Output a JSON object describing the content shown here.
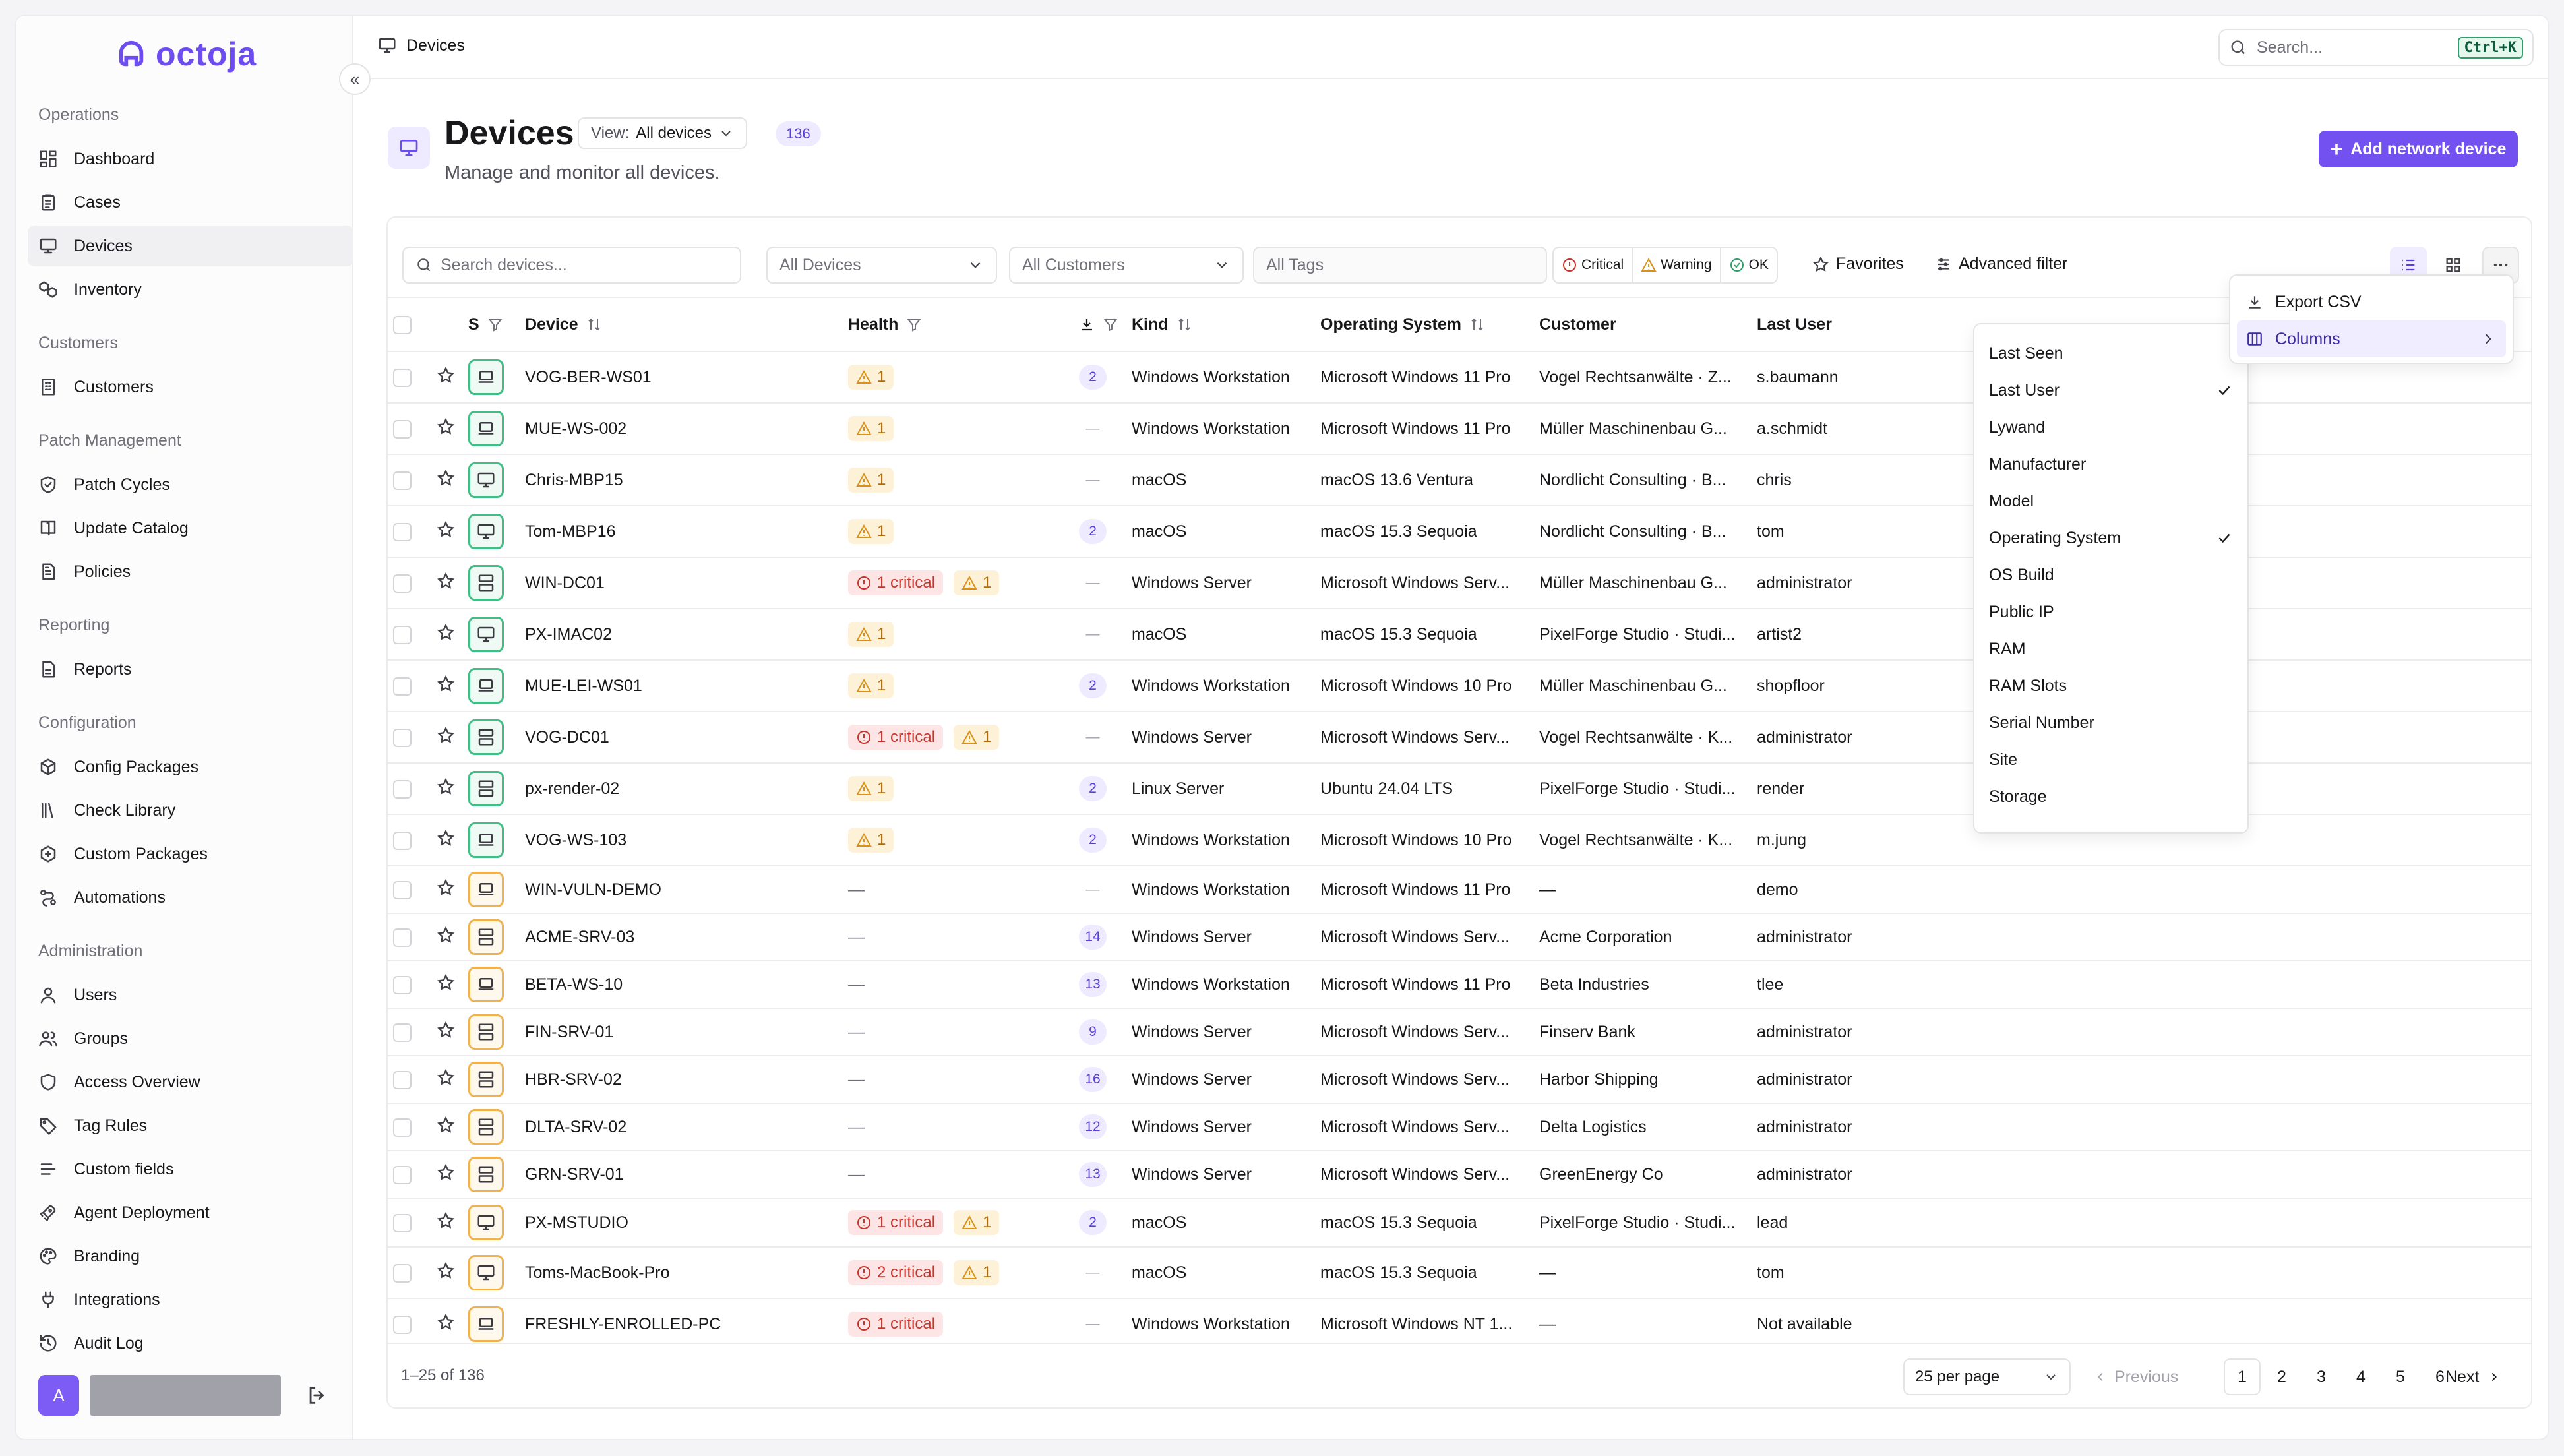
{
  "app": {
    "name": "octoja"
  },
  "sidebar": {
    "sections": [
      {
        "title": "Operations",
        "items": [
          {
            "label": "Dashboard",
            "icon": "dashboard-icon",
            "active": false
          },
          {
            "label": "Cases",
            "icon": "clipboard-icon",
            "active": false
          },
          {
            "label": "Devices",
            "icon": "monitor-icon",
            "active": true
          },
          {
            "label": "Inventory",
            "icon": "boxes-icon",
            "active": false
          }
        ]
      },
      {
        "title": "Customers",
        "items": [
          {
            "label": "Customers",
            "icon": "building-icon",
            "active": false
          }
        ]
      },
      {
        "title": "Patch Management",
        "items": [
          {
            "label": "Patch Cycles",
            "icon": "shield-check-icon",
            "active": false
          },
          {
            "label": "Update Catalog",
            "icon": "book-icon",
            "active": false
          },
          {
            "label": "Policies",
            "icon": "file-text-icon",
            "active": false
          }
        ]
      },
      {
        "title": "Reporting",
        "items": [
          {
            "label": "Reports",
            "icon": "report-icon",
            "active": false
          }
        ]
      },
      {
        "title": "Configuration",
        "items": [
          {
            "label": "Config Packages",
            "icon": "package-icon",
            "active": false
          },
          {
            "label": "Check Library",
            "icon": "library-icon",
            "active": false
          },
          {
            "label": "Custom Packages",
            "icon": "package-plus-icon",
            "active": false
          },
          {
            "label": "Automations",
            "icon": "workflow-icon",
            "active": false
          }
        ]
      },
      {
        "title": "Administration",
        "items": [
          {
            "label": "Users",
            "icon": "user-icon",
            "active": false
          },
          {
            "label": "Groups",
            "icon": "users-icon",
            "active": false
          },
          {
            "label": "Access Overview",
            "icon": "shield-icon",
            "active": false
          },
          {
            "label": "Tag Rules",
            "icon": "tag-icon",
            "active": false
          },
          {
            "label": "Custom fields",
            "icon": "list-icon",
            "active": false
          },
          {
            "label": "Agent Deployment",
            "icon": "rocket-icon",
            "active": false
          },
          {
            "label": "Branding",
            "icon": "palette-icon",
            "active": false
          },
          {
            "label": "Integrations",
            "icon": "plug-icon",
            "active": false
          },
          {
            "label": "Audit Log",
            "icon": "history-icon",
            "active": false
          }
        ]
      }
    ],
    "user": {
      "initial": "A"
    }
  },
  "topbar": {
    "breadcrumb": "Devices",
    "search_placeholder": "Search...",
    "shortcut": "Ctrl+K"
  },
  "page": {
    "title": "Devices",
    "view_prefix": "View:",
    "view_value": "All devices",
    "count": "136",
    "subtitle": "Manage and monitor all devices.",
    "add_button": "Add network device"
  },
  "filters": {
    "search_placeholder": "Search devices...",
    "devices": "All Devices",
    "customers": "All Customers",
    "tags_placeholder": "All Tags",
    "critical": "Critical",
    "warning": "Warning",
    "ok": "OK",
    "favorites": "Favorites",
    "advanced": "Advanced filter"
  },
  "table": {
    "headers": {
      "status": "S",
      "device": "Device",
      "health": "Health",
      "kind": "Kind",
      "os": "Operating System",
      "customer": "Customer",
      "last_user": "Last User"
    },
    "rows": [
      {
        "icon": "laptop",
        "tone": "ok",
        "device": "VOG-BER-WS01",
        "critical": "",
        "warning": "1",
        "updates": "2",
        "kind": "Windows Workstation",
        "os": "Microsoft Windows 11 Pro",
        "customer": "Vogel Rechtsanwälte · Z...",
        "user": "s.baumann"
      },
      {
        "icon": "laptop",
        "tone": "ok",
        "device": "MUE-WS-002",
        "critical": "",
        "warning": "1",
        "updates": "—",
        "kind": "Windows Workstation",
        "os": "Microsoft Windows 11 Pro",
        "customer": "Müller Maschinenbau G...",
        "user": "a.schmidt"
      },
      {
        "icon": "desktop",
        "tone": "ok",
        "device": "Chris-MBP15",
        "critical": "",
        "warning": "1",
        "updates": "—",
        "kind": "macOS",
        "os": "macOS 13.6 Ventura",
        "customer": "Nordlicht Consulting · B...",
        "user": "chris"
      },
      {
        "icon": "desktop",
        "tone": "ok",
        "device": "Tom-MBP16",
        "critical": "",
        "warning": "1",
        "updates": "2",
        "kind": "macOS",
        "os": "macOS 15.3 Sequoia",
        "customer": "Nordlicht Consulting · B...",
        "user": "tom"
      },
      {
        "icon": "server",
        "tone": "ok",
        "device": "WIN-DC01",
        "critical": "1 critical",
        "warning": "1",
        "updates": "—",
        "kind": "Windows Server",
        "os": "Microsoft Windows Serv...",
        "customer": "Müller Maschinenbau G...",
        "user": "administrator"
      },
      {
        "icon": "desktop",
        "tone": "ok",
        "device": "PX-IMAC02",
        "critical": "",
        "warning": "1",
        "updates": "—",
        "kind": "macOS",
        "os": "macOS 15.3 Sequoia",
        "customer": "PixelForge Studio · Studi...",
        "user": "artist2"
      },
      {
        "icon": "laptop",
        "tone": "ok",
        "device": "MUE-LEI-WS01",
        "critical": "",
        "warning": "1",
        "updates": "2",
        "kind": "Windows Workstation",
        "os": "Microsoft Windows 10 Pro",
        "customer": "Müller Maschinenbau G...",
        "user": "shopfloor"
      },
      {
        "icon": "server",
        "tone": "ok",
        "device": "VOG-DC01",
        "critical": "1 critical",
        "warning": "1",
        "updates": "—",
        "kind": "Windows Server",
        "os": "Microsoft Windows Serv...",
        "customer": "Vogel Rechtsanwälte · K...",
        "user": "administrator"
      },
      {
        "icon": "server",
        "tone": "ok",
        "device": "px-render-02",
        "critical": "",
        "warning": "1",
        "updates": "2",
        "kind": "Linux Server",
        "os": "Ubuntu 24.04 LTS",
        "customer": "PixelForge Studio · Studi...",
        "user": "render"
      },
      {
        "icon": "laptop",
        "tone": "ok",
        "device": "VOG-WS-103",
        "critical": "",
        "warning": "1",
        "updates": "2",
        "kind": "Windows Workstation",
        "os": "Microsoft Windows 10 Pro",
        "customer": "Vogel Rechtsanwälte · K...",
        "user": "m.jung"
      },
      {
        "icon": "laptop",
        "tone": "warn",
        "device": "WIN-VULN-DEMO",
        "critical": "",
        "warning": "",
        "updates": "—",
        "kind": "Windows Workstation",
        "os": "Microsoft Windows 11 Pro",
        "customer": "—",
        "user": "demo"
      },
      {
        "icon": "server",
        "tone": "warn",
        "device": "ACME-SRV-03",
        "critical": "",
        "warning": "",
        "updates": "14",
        "kind": "Windows Server",
        "os": "Microsoft Windows Serv...",
        "customer": "Acme Corporation",
        "user": "administrator"
      },
      {
        "icon": "laptop",
        "tone": "warn",
        "device": "BETA-WS-10",
        "critical": "",
        "warning": "",
        "updates": "13",
        "kind": "Windows Workstation",
        "os": "Microsoft Windows 11 Pro",
        "customer": "Beta Industries",
        "user": "tlee"
      },
      {
        "icon": "server",
        "tone": "warn",
        "device": "FIN-SRV-01",
        "critical": "",
        "warning": "",
        "updates": "9",
        "kind": "Windows Server",
        "os": "Microsoft Windows Serv...",
        "customer": "Finserv Bank",
        "user": "administrator"
      },
      {
        "icon": "server",
        "tone": "warn",
        "device": "HBR-SRV-02",
        "critical": "",
        "warning": "",
        "updates": "16",
        "kind": "Windows Server",
        "os": "Microsoft Windows Serv...",
        "customer": "Harbor Shipping",
        "user": "administrator"
      },
      {
        "icon": "server",
        "tone": "warn",
        "device": "DLTA-SRV-02",
        "critical": "",
        "warning": "",
        "updates": "12",
        "kind": "Windows Server",
        "os": "Microsoft Windows Serv...",
        "customer": "Delta Logistics",
        "user": "administrator"
      },
      {
        "icon": "server",
        "tone": "warn",
        "device": "GRN-SRV-01",
        "critical": "",
        "warning": "",
        "updates": "13",
        "kind": "Windows Server",
        "os": "Microsoft Windows Serv...",
        "customer": "GreenEnergy Co",
        "user": "administrator"
      },
      {
        "icon": "desktop",
        "tone": "warn",
        "device": "PX-MSTUDIO",
        "critical": "1 critical",
        "warning": "1",
        "updates": "2",
        "kind": "macOS",
        "os": "macOS 15.3 Sequoia",
        "customer": "PixelForge Studio · Studi...",
        "user": "lead"
      },
      {
        "icon": "desktop",
        "tone": "warn",
        "device": "Toms-MacBook-Pro",
        "critical": "2 critical",
        "warning": "1",
        "updates": "—",
        "kind": "macOS",
        "os": "macOS 15.3 Sequoia",
        "customer": "—",
        "user": "tom"
      },
      {
        "icon": "laptop",
        "tone": "warn",
        "device": "FRESHLY-ENROLLED-PC",
        "critical": "1 critical",
        "warning": "",
        "updates": "—",
        "kind": "Windows Workstation",
        "os": "Microsoft Windows NT 1...",
        "customer": "—",
        "user": "Not available"
      }
    ]
  },
  "pagination": {
    "range": "1–25 of 136",
    "per_page": "25 per page",
    "previous": "Previous",
    "next": "Next",
    "pages": [
      "1",
      "2",
      "3",
      "4",
      "5",
      "6"
    ],
    "current": "1"
  },
  "actions_menu": {
    "items": [
      {
        "label": "Export CSV",
        "icon": "download-icon"
      },
      {
        "label": "Columns",
        "icon": "columns-icon",
        "selected": true
      }
    ]
  },
  "columns_menu": {
    "items": [
      {
        "label": "Last Seen",
        "checked": false
      },
      {
        "label": "Last User",
        "checked": true
      },
      {
        "label": "Lywand",
        "checked": false
      },
      {
        "label": "Manufacturer",
        "checked": false
      },
      {
        "label": "Model",
        "checked": false
      },
      {
        "label": "Operating System",
        "checked": true
      },
      {
        "label": "OS Build",
        "checked": false
      },
      {
        "label": "Public IP",
        "checked": false
      },
      {
        "label": "RAM",
        "checked": false
      },
      {
        "label": "RAM Slots",
        "checked": false
      },
      {
        "label": "Serial Number",
        "checked": false
      },
      {
        "label": "Site",
        "checked": false
      },
      {
        "label": "Storage",
        "checked": false
      }
    ]
  },
  "colors": {
    "accent": "#7251f0",
    "ok": "#3fbf85",
    "warning": "#f0b24e",
    "critical": "#c7352c"
  }
}
